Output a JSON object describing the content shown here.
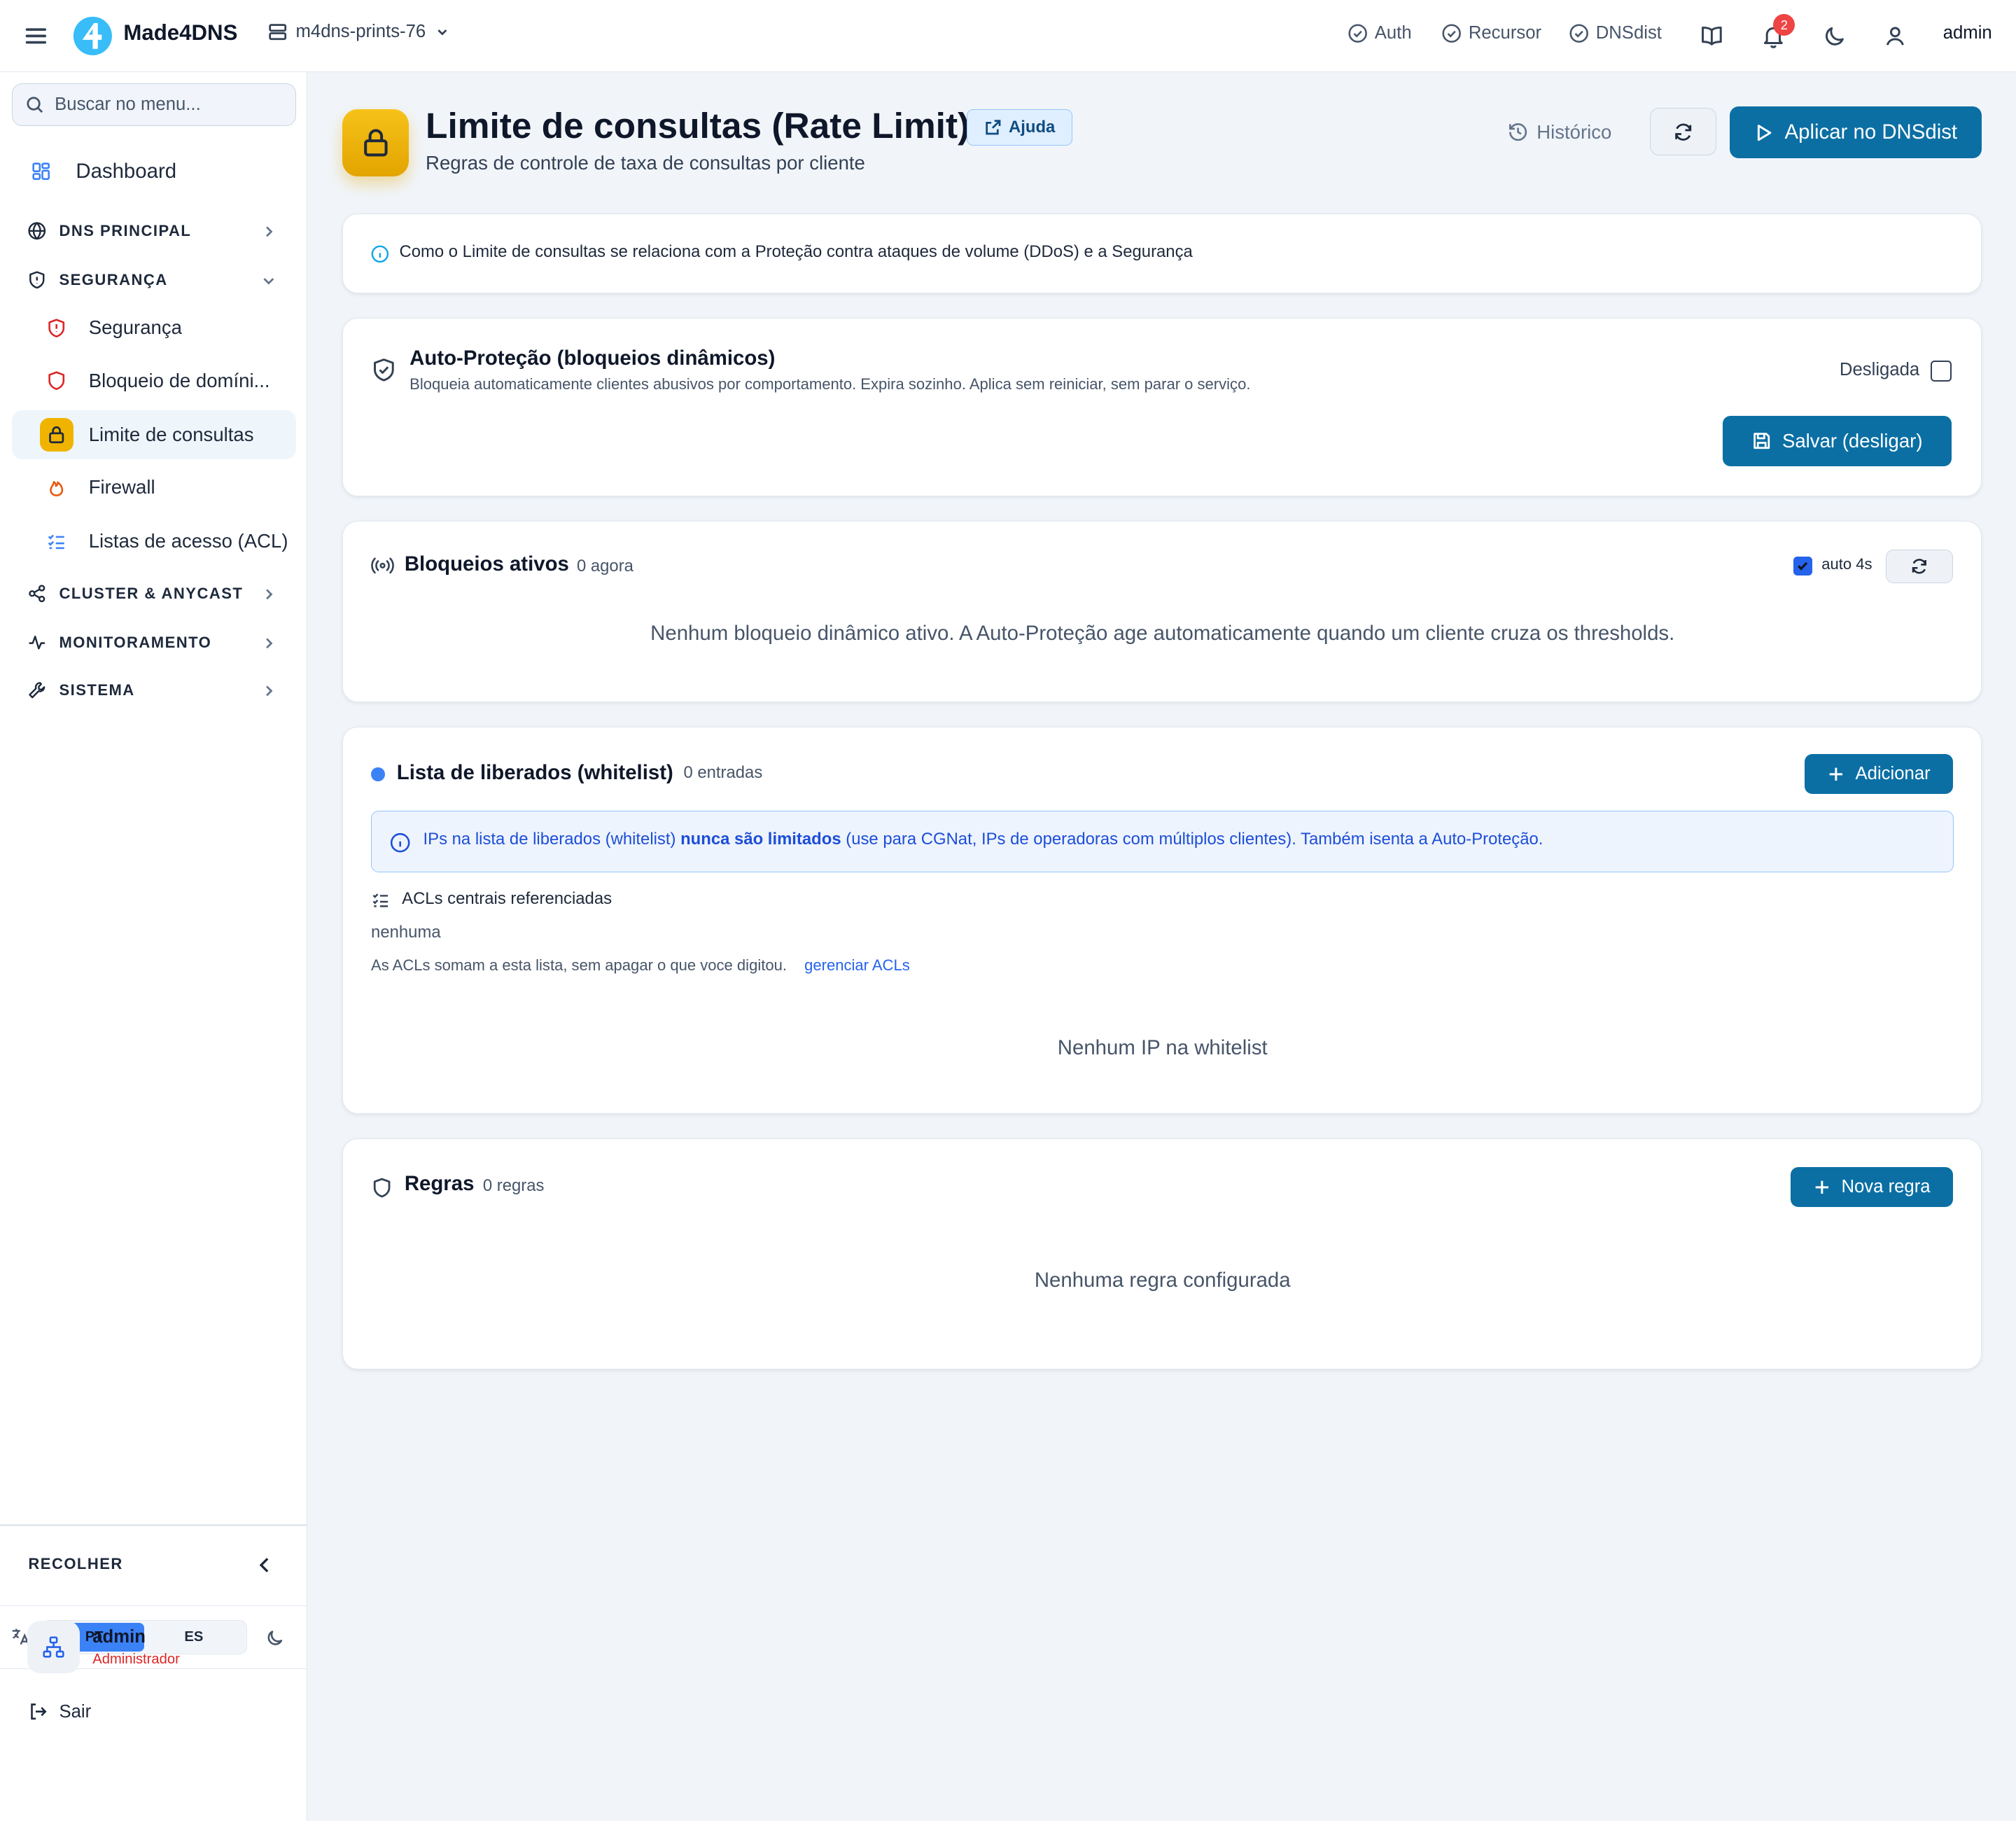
{
  "topbar": {
    "brand": "Made4DNS",
    "server": "m4dns-prints-76",
    "services": [
      "Auth",
      "Recursor",
      "DNSdist"
    ],
    "notif_count": "2",
    "user": "admin"
  },
  "sidebar": {
    "search_placeholder": "Buscar no menu...",
    "dashboard": "Dashboard",
    "groups": {
      "dns": "DNS PRINCIPAL",
      "seguranca": "SEGURANÇA",
      "cluster": "CLUSTER & ANYCAST",
      "monitor": "MONITORAMENTO",
      "sistema": "SISTEMA"
    },
    "sub": [
      "Segurança",
      "Bloqueio de domíni...",
      "Limite de consultas",
      "Firewall",
      "Listas de acesso (ACL)"
    ],
    "collapse": "RECOLHER",
    "lang": [
      "PT",
      "ES"
    ],
    "user_name": "admin",
    "user_role": "Administrador",
    "logout": "Sair"
  },
  "header": {
    "title": "Limite de consultas (Rate Limit)",
    "help": "Ajuda",
    "subtitle": "Regras de controle de taxa de consultas por cliente",
    "history": "Histórico",
    "apply": "Aplicar no DNSdist"
  },
  "info_card": {
    "text": "Como o Limite de consultas se relaciona com a Proteção contra ataques de volume (DDoS) e a Segurança"
  },
  "auto_protect": {
    "title": "Auto-Proteção (bloqueios dinâmicos)",
    "desc": "Bloqueia automaticamente clientes abusivos por comportamento. Expira sozinho. Aplica sem reiniciar, sem parar o serviço.",
    "state": "Desligada",
    "save": "Salvar (desligar)"
  },
  "blocks": {
    "title": "Bloqueios ativos",
    "count": "0 agora",
    "auto": "auto 4s",
    "empty": "Nenhum bloqueio dinâmico ativo. A Auto-Proteção age automaticamente quando um cliente cruza os thresholds."
  },
  "whitelist": {
    "title": "Lista de liberados (whitelist)",
    "count": "0 entradas",
    "add": "Adicionar",
    "info_pre": "IPs na lista de liberados (whitelist) ",
    "info_bold": "nunca são limitados",
    "info_post": " (use para CGNat, IPs de operadoras com múltiplos clientes). Também isenta a Auto-Proteção.",
    "acl_label": "ACLs centrais referenciadas",
    "acl_value": "nenhuma",
    "acl_note": "As ACLs somam a esta lista, sem apagar o que voce digitou.",
    "acl_link": "gerenciar ACLs",
    "empty": "Nenhum IP na whitelist"
  },
  "rules": {
    "title": "Regras",
    "count": "0 regras",
    "new": "Nova regra",
    "empty": "Nenhuma regra configurada"
  }
}
